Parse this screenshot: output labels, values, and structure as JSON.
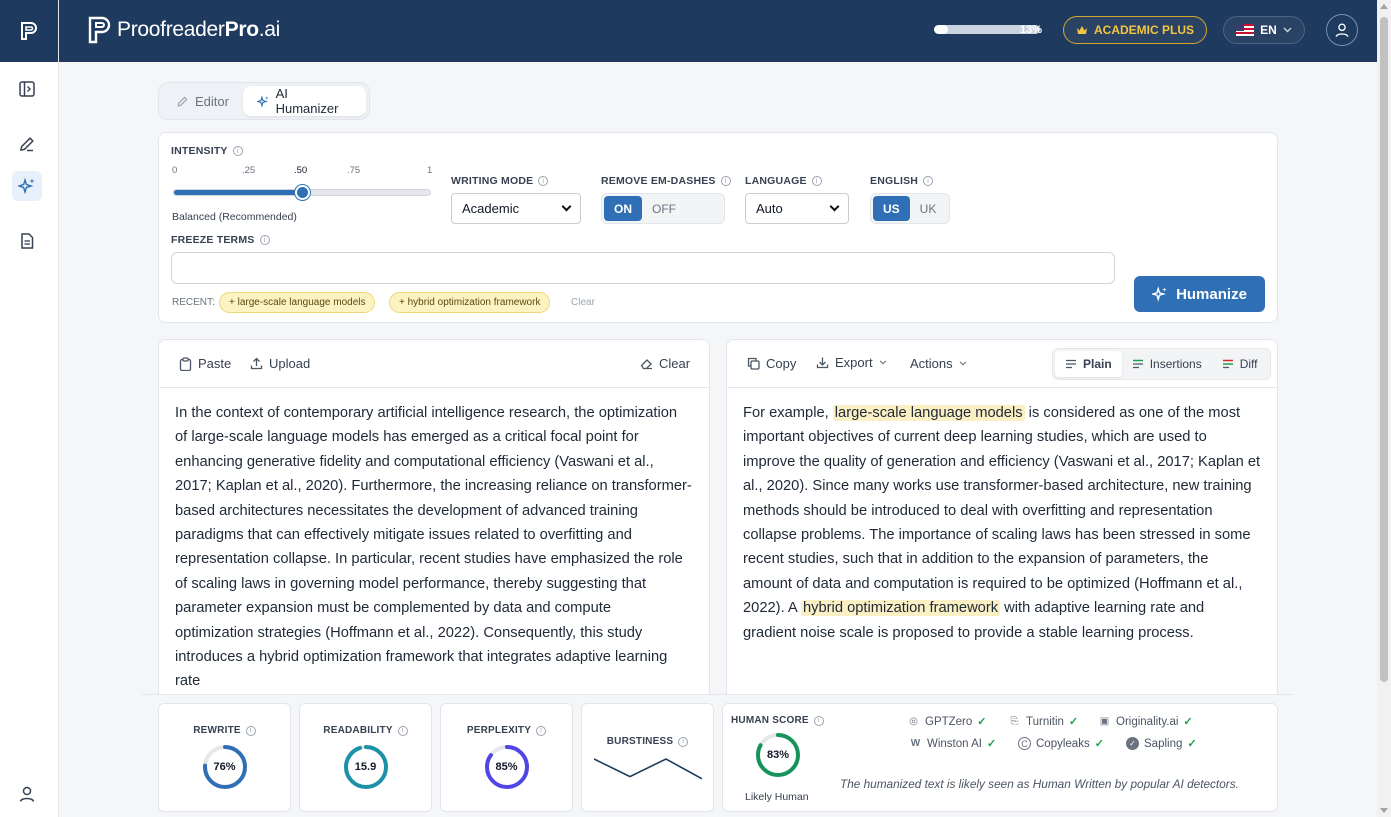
{
  "header": {
    "brand_light": "Proofreader",
    "brand_bold": "Pro",
    "brand_suffix": ".ai",
    "usage_percent": 13,
    "usage_label": "13%",
    "plan_label": "ACADEMIC PLUS",
    "language_label": "EN"
  },
  "sidebar": {
    "items": [
      {
        "name": "sidebar-toggle",
        "icon": "panel-icon"
      },
      {
        "name": "editor",
        "icon": "pen-icon"
      },
      {
        "name": "ai-humanizer",
        "icon": "sparkles-icon",
        "active": true
      },
      {
        "name": "documents",
        "icon": "document-icon"
      },
      {
        "name": "account",
        "icon": "user-icon"
      }
    ]
  },
  "mode_tabs": [
    {
      "label": "Editor",
      "icon": "pencil-icon",
      "active": false
    },
    {
      "label": "AI Humanizer",
      "icon": "sparkles-icon",
      "active": true
    }
  ],
  "settings": {
    "intensity": {
      "label": "INTENSITY",
      "ticks": [
        "0",
        ".25",
        ".50",
        ".75",
        "1"
      ],
      "value": 0.5,
      "caption": "Balanced (Recommended)"
    },
    "writing_mode": {
      "label": "WRITING MODE",
      "value": "Academic"
    },
    "remove_em_dashes": {
      "label": "REMOVE EM-DASHES",
      "on_label": "ON",
      "off_label": "OFF",
      "selected": "ON"
    },
    "language": {
      "label": "LANGUAGE",
      "value": "Auto"
    },
    "english": {
      "label": "ENGLISH",
      "us_label": "US",
      "uk_label": "UK",
      "selected": "US"
    },
    "freeze_terms": {
      "label": "FREEZE TERMS",
      "value": "",
      "recent_label": "RECENT:",
      "recent": [
        "+ large-scale language models",
        "+ hybrid optimization framework"
      ],
      "clear_label": "Clear"
    },
    "humanize_label": "Humanize"
  },
  "input_panel": {
    "paste_label": "Paste",
    "upload_label": "Upload",
    "clear_label": "Clear",
    "text": "In the context of contemporary artificial intelligence research, the optimization of large-scale language models has emerged as a critical focal point for enhancing generative fidelity and computational efficiency (Vaswani et al., 2017; Kaplan et al., 2020). Furthermore, the increasing reliance on transformer-based architectures necessitates the development of advanced training paradigms that can effectively mitigate issues related to overfitting and representation collapse. In particular, recent studies have emphasized the role of scaling laws in governing model performance, thereby suggesting that parameter expansion must be complemented by data and compute optimization strategies (Hoffmann et al., 2022). Consequently, this study introduces a hybrid optimization framework that integrates adaptive learning rate"
  },
  "output_panel": {
    "copy_label": "Copy",
    "export_label": "Export",
    "actions_label": "Actions",
    "views": [
      "Plain",
      "Insertions",
      "Diff"
    ],
    "active_view": "Plain",
    "segments": [
      {
        "text": "For example, ",
        "hl": false
      },
      {
        "text": "large-scale language models",
        "hl": true
      },
      {
        "text": " is considered as one of the most important objectives of current deep learning studies, which are used to improve the quality of generation and efficiency (Vaswani et al., 2017; Kaplan et al., 2020). Since many works use transformer-based architecture, new training methods should be introduced to deal with overfitting and representation collapse problems. The importance of scaling laws has been stressed in some recent studies, such that in addition to the expansion of parameters, the amount of data and computation is required to be optimized (Hoffmann et al., 2022). A ",
        "hl": false
      },
      {
        "text": "hybrid optimization framework",
        "hl": true
      },
      {
        "text": " with adaptive learning rate and gradient noise scale is proposed to provide a stable learning process.",
        "hl": false
      }
    ]
  },
  "metrics": {
    "rewrite": {
      "label": "REWRITE",
      "value_label": "76%",
      "fraction": 0.76,
      "color": "#2f6fb5"
    },
    "readability": {
      "label": "READABILITY",
      "value_label": "15.9",
      "fraction": 0.95,
      "color": "#1c91a8"
    },
    "perplexity": {
      "label": "PERPLEXITY",
      "value_label": "85%",
      "fraction": 0.85,
      "color": "#4f46e5"
    },
    "burstiness": {
      "label": "BURSTINESS",
      "series": [
        1,
        0.2,
        1,
        0.1
      ]
    },
    "human_score": {
      "label": "HUMAN SCORE",
      "value_label": "83%",
      "fraction": 0.83,
      "color": "#15935a",
      "caption": "Likely Human",
      "detectors": [
        {
          "name": "GPTZero",
          "icon": "gptzero-icon"
        },
        {
          "name": "Turnitin",
          "icon": "turnitin-icon"
        },
        {
          "name": "Originality.ai",
          "icon": "originality-icon"
        },
        {
          "name": "Winston AI",
          "icon": "winston-icon"
        },
        {
          "name": "Copyleaks",
          "icon": "copyleaks-icon"
        },
        {
          "name": "Sapling",
          "icon": "sapling-icon"
        }
      ],
      "note": "The humanized text is likely seen as Human Written by popular AI detectors."
    }
  }
}
